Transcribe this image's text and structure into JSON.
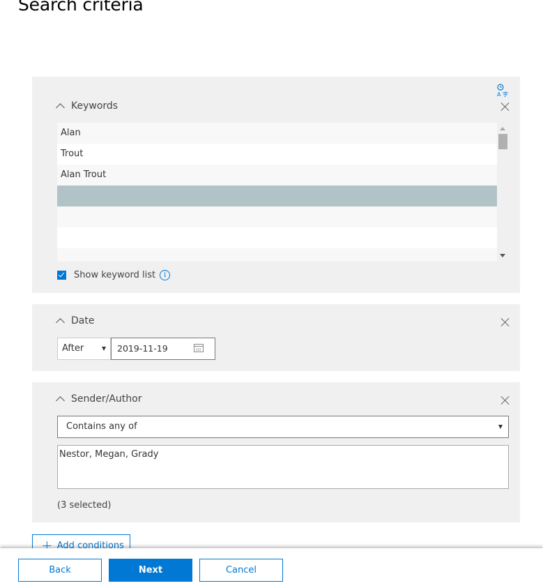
{
  "page": {
    "title": "Search criteria"
  },
  "keywords": {
    "header": "Keywords",
    "language_icon": "language-settings-icon",
    "items": [
      "Alan",
      "Trout",
      "Alan Trout",
      "",
      "",
      "",
      ""
    ],
    "selected_index": 3,
    "show_keyword_list_label": "Show keyword list",
    "show_keyword_list_checked": true,
    "info_glyph": "i"
  },
  "date": {
    "header": "Date",
    "operator": "After",
    "value": "2019-11-19"
  },
  "sender": {
    "header": "Sender/Author",
    "operator": "Contains any of",
    "value": "Nestor, Megan, Grady",
    "selected_count": "(3 selected)"
  },
  "actions": {
    "add_conditions_label": "Add conditions",
    "add_glyph": "+"
  },
  "footer": {
    "back_label": "Back",
    "next_label": "Next",
    "cancel_label": "Cancel"
  },
  "colors": {
    "accent": "#0078d4",
    "card_bg": "#f0f0f0",
    "selected_row": "#b1c3c6"
  }
}
